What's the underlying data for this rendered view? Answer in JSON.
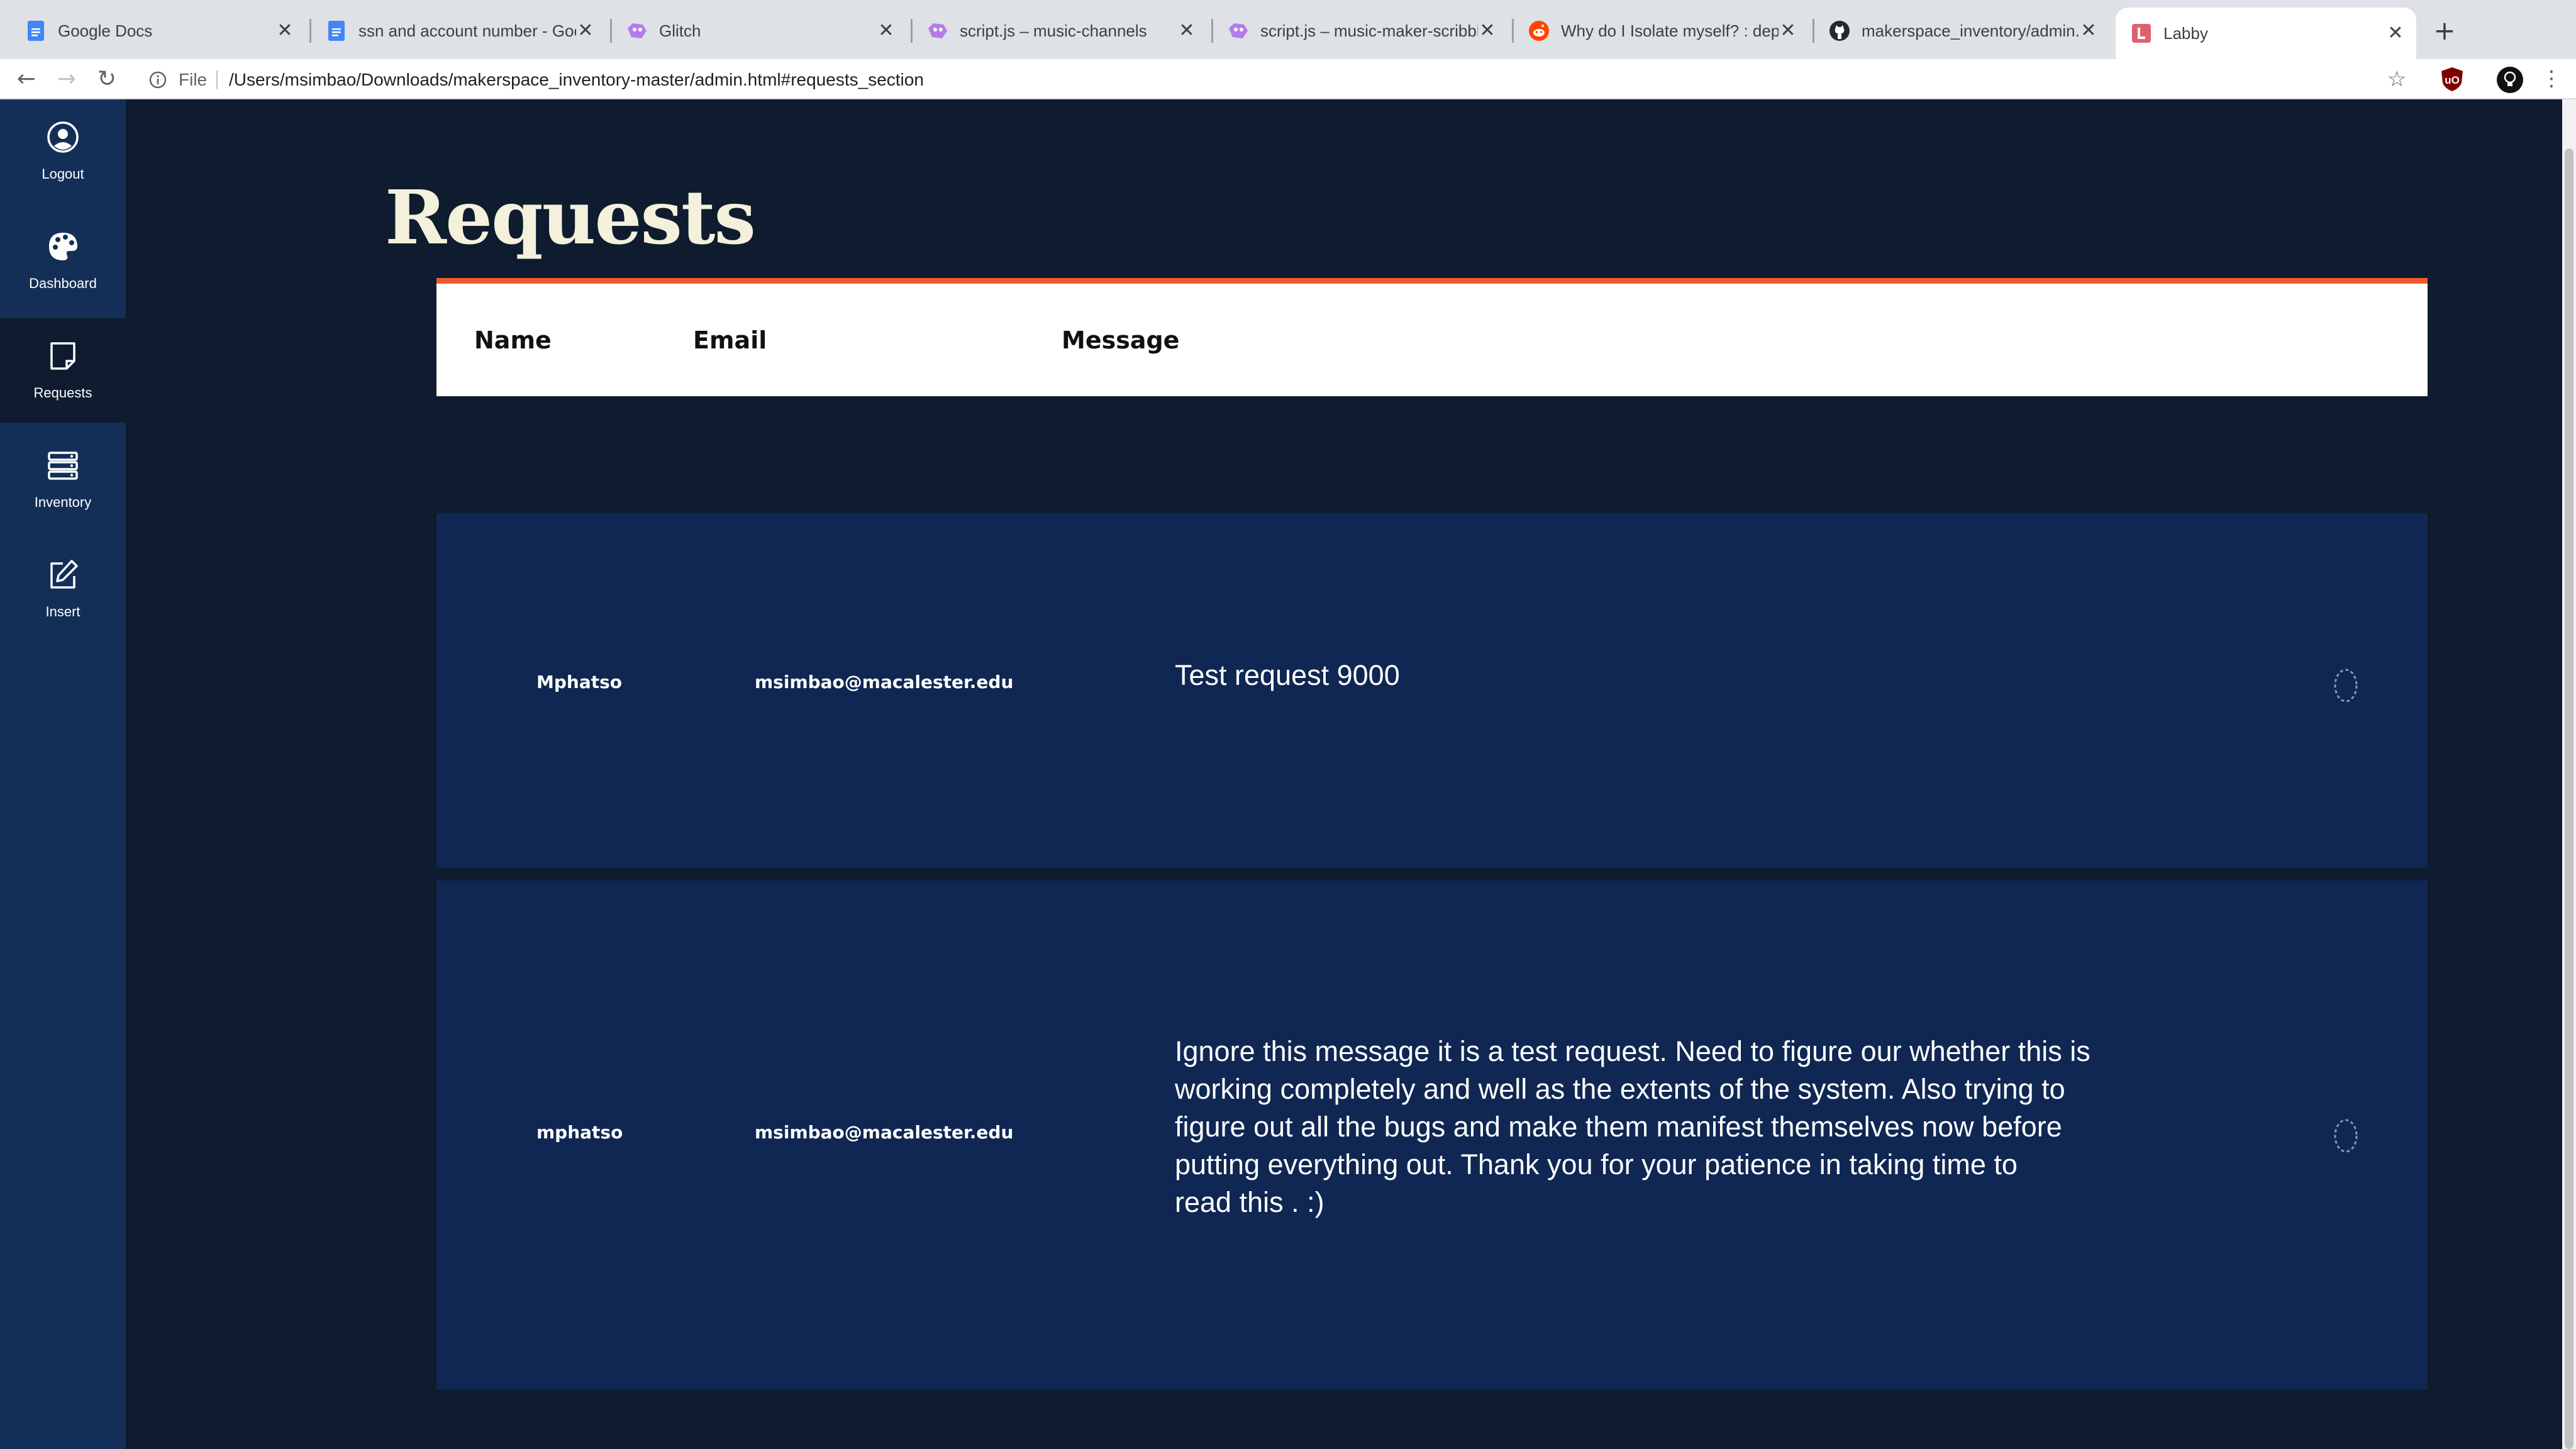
{
  "browser": {
    "tabs": [
      {
        "title": "Google Docs",
        "icon": "google-docs-icon",
        "active": false
      },
      {
        "title": "ssn and account number - Goo",
        "icon": "google-docs-icon",
        "active": false
      },
      {
        "title": "Glitch",
        "icon": "glitch-icon",
        "active": false
      },
      {
        "title": "script.js – music-channels",
        "icon": "glitch-icon",
        "active": false
      },
      {
        "title": "script.js – music-maker-scribbl",
        "icon": "glitch-icon",
        "active": false
      },
      {
        "title": "Why do I Isolate myself? : depr",
        "icon": "reddit-icon",
        "active": false
      },
      {
        "title": "makerspace_inventory/admin.js",
        "icon": "github-icon",
        "active": false
      },
      {
        "title": "Labby",
        "icon": "labby-icon",
        "active": true
      }
    ],
    "new_tab_symbol": "+",
    "close_symbol": "✕",
    "address": {
      "scheme_label": "File",
      "url": "/Users/msimbao/Downloads/makerspace_inventory-master/admin.html#requests_section"
    }
  },
  "sidebar": {
    "items": [
      {
        "label": "Logout",
        "icon": "user-circle-icon",
        "active": false
      },
      {
        "label": "Dashboard",
        "icon": "palette-icon",
        "active": false
      },
      {
        "label": "Requests",
        "icon": "sticky-note-icon",
        "active": true
      },
      {
        "label": "Inventory",
        "icon": "server-icon",
        "active": false
      },
      {
        "label": "Insert",
        "icon": "edit-icon",
        "active": false
      }
    ]
  },
  "main": {
    "title": "Requests",
    "table": {
      "headers": {
        "name": "Name",
        "email": "Email",
        "message": "Message"
      },
      "rows": [
        {
          "name": "Mphatso",
          "email": "msimbao@macalester.edu",
          "message_lines": [
            "Test request 9000"
          ],
          "action_icon": "loading-icon"
        },
        {
          "name": "mphatso",
          "email": "msimbao@macalester.edu",
          "message_lines": [
            "Ignore this message it is a test request. Need to figure our whether this is",
            "working completely and well as the extents of the system. Also trying to",
            "figure out all the bugs and make them manifest themselves now before",
            "putting everything out. Thank you for your patience in taking time to",
            "read this . :)"
          ],
          "action_icon": "loading-icon"
        }
      ]
    }
  },
  "colors": {
    "sidebar_bg": "#142f57",
    "page_bg": "#0f1b2e",
    "row_bg": "#0f2752",
    "header_accent": "#f25a2e",
    "heading_text": "#f3f0dc"
  }
}
